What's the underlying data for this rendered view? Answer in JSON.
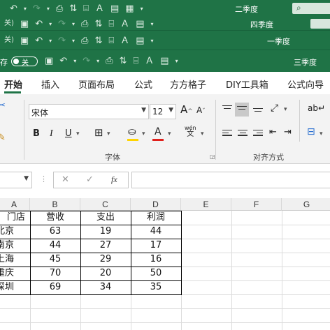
{
  "windows": [
    {
      "title": "二季度"
    },
    {
      "title": "四季度"
    },
    {
      "title": "一季度"
    },
    {
      "title": "三季度",
      "autosave_prefix": "存",
      "autosave_state": "关"
    }
  ],
  "ribbon_tabs": [
    "开始",
    "插入",
    "页面布局",
    "公式",
    "方方格子",
    "DIY工具箱",
    "公式向导"
  ],
  "font": {
    "name": "宋体",
    "size": "12",
    "grow": "A",
    "shrink": "A"
  },
  "format_buttons": {
    "bold": "B",
    "italic": "I",
    "underline": "U",
    "font_color": "A",
    "phonetic_top": "wén",
    "phonetic_bottom": "文"
  },
  "groups": {
    "font_label": "字体",
    "align_label": "对齐方式"
  },
  "formula_bar": {
    "cancel": "✕",
    "enter": "✓",
    "fx": "fx",
    "value": ""
  },
  "columns": [
    "A",
    "B",
    "C",
    "D",
    "E",
    "F",
    "G"
  ],
  "table": {
    "headers": [
      "门店",
      "营收",
      "支出",
      "利润"
    ],
    "rows": [
      [
        "北京",
        "63",
        "19",
        "44"
      ],
      [
        "南京",
        "44",
        "27",
        "17"
      ],
      [
        "上海",
        "45",
        "29",
        "16"
      ],
      [
        "重庆",
        "70",
        "20",
        "50"
      ],
      [
        "深圳",
        "69",
        "34",
        "35"
      ]
    ]
  },
  "colors": {
    "title_bar": "#1f7346",
    "accent_yellow": "#ffd400",
    "accent_red": "#e0201b"
  }
}
